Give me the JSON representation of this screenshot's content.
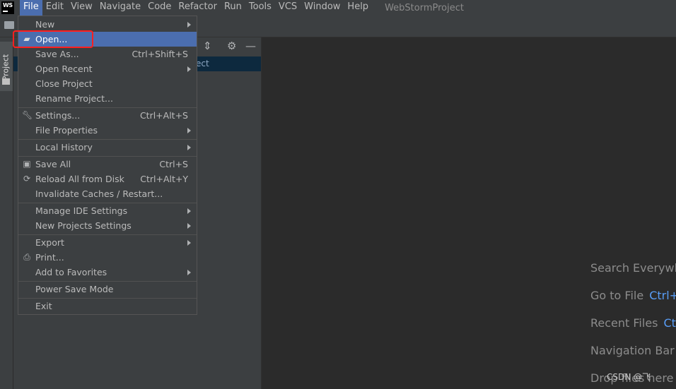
{
  "menubar": {
    "items": [
      "File",
      "Edit",
      "View",
      "Navigate",
      "Code",
      "Refactor",
      "Run",
      "Tools",
      "VCS",
      "Window",
      "Help"
    ],
    "window_title": "WebStormProject"
  },
  "logo_text": "WS",
  "toolstrip": {
    "project_label": "Project"
  },
  "project_pane": {
    "selected_row_fragment": "ect"
  },
  "file_menu": {
    "new": "New",
    "open": "Open...",
    "save_as": "Save As...",
    "save_as_shortcut": "Ctrl+Shift+S",
    "open_recent": "Open Recent",
    "close_project": "Close Project",
    "rename_project": "Rename Project...",
    "settings": "Settings...",
    "settings_shortcut": "Ctrl+Alt+S",
    "file_properties": "File Properties",
    "local_history": "Local History",
    "save_all": "Save All",
    "save_all_shortcut": "Ctrl+S",
    "reload_all": "Reload All from Disk",
    "reload_all_shortcut": "Ctrl+Alt+Y",
    "invalidate_caches": "Invalidate Caches / Restart...",
    "manage_ide_settings": "Manage IDE Settings",
    "new_projects_settings": "New Projects Settings",
    "export": "Export",
    "print": "Print...",
    "add_to_favorites": "Add to Favorites",
    "power_save_mode": "Power Save Mode",
    "exit": "Exit"
  },
  "editor_tips": {
    "search_everywhere": "Search Everywhe",
    "go_to_file": "Go to File",
    "go_to_file_key": "Ctrl+",
    "recent_files": "Recent Files",
    "recent_files_key": "Ctr",
    "navigation_bar": "Navigation Bar",
    "drop_files": "Drop files here t",
    "watermark": "CSDN @飞"
  },
  "colors": {
    "highlight": "#4b6eaf",
    "annotation_box": "#ff1f1f",
    "shortcut_blue": "#589df6"
  }
}
